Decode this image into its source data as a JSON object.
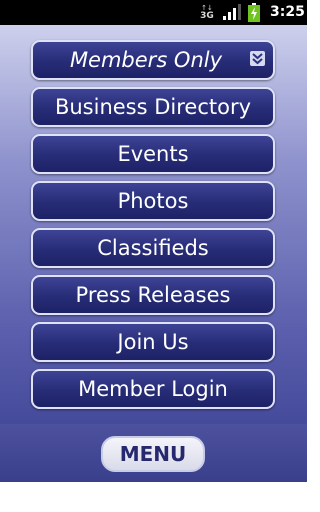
{
  "status_bar": {
    "network": "3G",
    "time": "3:25",
    "signal_icon": "signal-bars-icon",
    "battery_icon": "battery-charging-icon"
  },
  "menu": {
    "items": [
      {
        "label": "Members Only",
        "icon": "chevron-double-down-icon"
      },
      {
        "label": "Business Directory"
      },
      {
        "label": "Events"
      },
      {
        "label": "Photos"
      },
      {
        "label": "Classifieds"
      },
      {
        "label": "Press Releases"
      },
      {
        "label": "Join Us"
      },
      {
        "label": "Member Login"
      }
    ]
  },
  "bottom_bar": {
    "menu_label": "MENU"
  },
  "colors": {
    "button_fill": "#272c77",
    "button_border": "#dfe2f6",
    "background_top": "#cdd0ec",
    "background_bottom": "#353b8d",
    "softkey_text": "#26296e"
  }
}
